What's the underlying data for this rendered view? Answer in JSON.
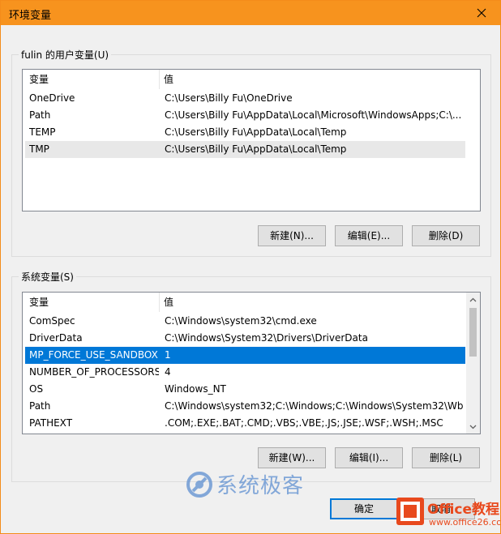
{
  "window": {
    "title": "环境变量",
    "close_icon": "close-icon"
  },
  "user_vars": {
    "group_label": "fulin 的用户变量(U)",
    "columns": [
      "变量",
      "值"
    ],
    "rows": [
      {
        "name": "OneDrive",
        "value": "C:\\Users\\Billy Fu\\OneDrive"
      },
      {
        "name": "Path",
        "value": "C:\\Users\\Billy Fu\\AppData\\Local\\Microsoft\\WindowsApps;C:\\..."
      },
      {
        "name": "TEMP",
        "value": "C:\\Users\\Billy Fu\\AppData\\Local\\Temp"
      },
      {
        "name": "TMP",
        "value": "C:\\Users\\Billy Fu\\AppData\\Local\\Temp"
      }
    ],
    "buttons": {
      "new": "新建(N)...",
      "edit": "编辑(E)...",
      "delete": "删除(D)"
    }
  },
  "system_vars": {
    "group_label": "系统变量(S)",
    "columns": [
      "变量",
      "值"
    ],
    "rows": [
      {
        "name": "ComSpec",
        "value": "C:\\Windows\\system32\\cmd.exe"
      },
      {
        "name": "DriverData",
        "value": "C:\\Windows\\System32\\Drivers\\DriverData"
      },
      {
        "name": "MP_FORCE_USE_SANDBOX",
        "value": "1"
      },
      {
        "name": "NUMBER_OF_PROCESSORS",
        "value": "4"
      },
      {
        "name": "OS",
        "value": "Windows_NT"
      },
      {
        "name": "Path",
        "value": "C:\\Windows\\system32;C:\\Windows;C:\\Windows\\System32\\Wb..."
      },
      {
        "name": "PATHEXT",
        "value": ".COM;.EXE;.BAT;.CMD;.VBS;.VBE;.JS;.JSE;.WSF;.WSH;.MSC"
      }
    ],
    "selected_index": 2,
    "buttons": {
      "new": "新建(W)...",
      "edit": "编辑(I)...",
      "delete": "删除(L)"
    }
  },
  "footer": {
    "ok": "确定",
    "cancel": "取消"
  },
  "watermarks": {
    "site1": "系统极客",
    "site2_title": "Office教程网",
    "site2_url": "www.office26.com"
  },
  "colors": {
    "titlebar": "#f7931e",
    "selection": "#0078d7"
  }
}
